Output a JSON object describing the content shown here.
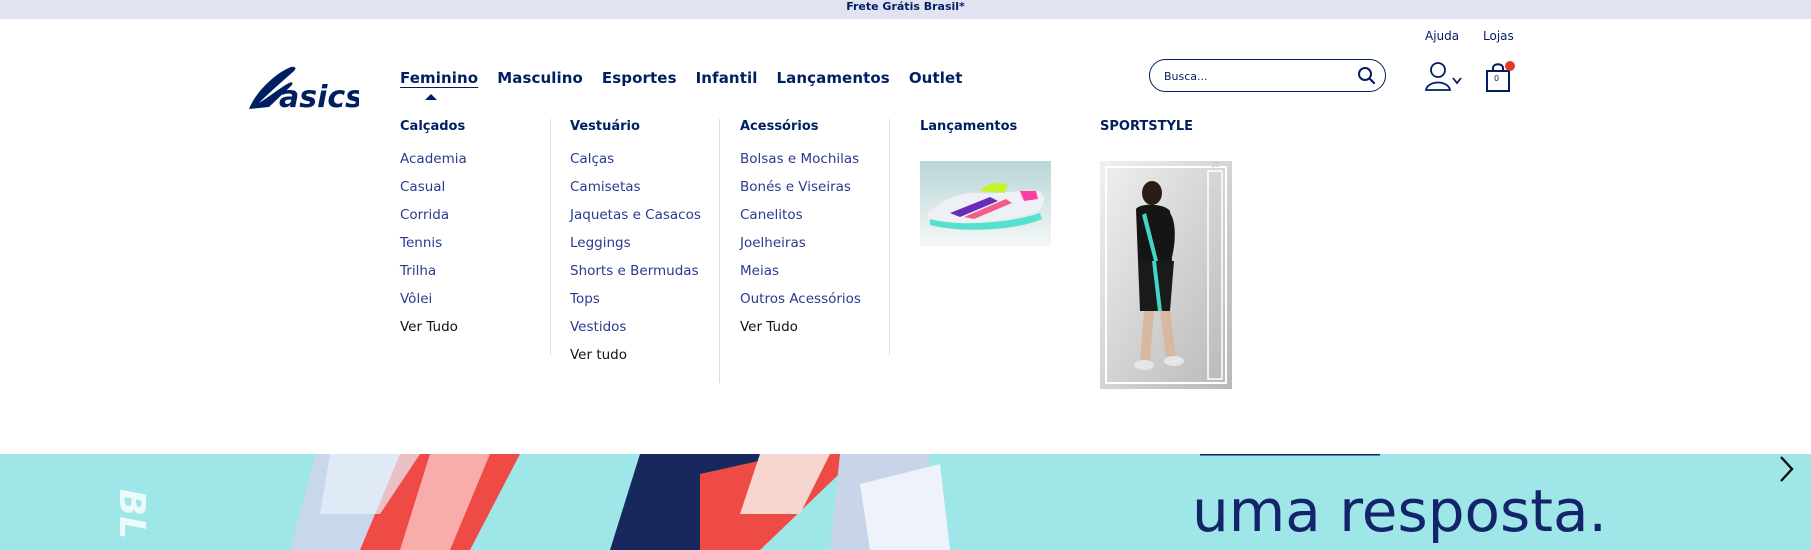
{
  "topbar": {
    "text": "Frete Grátis Brasil*"
  },
  "brand": {
    "logo_text": "asics"
  },
  "nav": {
    "items": [
      {
        "label": "Feminino"
      },
      {
        "label": "Masculino"
      },
      {
        "label": "Esportes"
      },
      {
        "label": "Infantil"
      },
      {
        "label": "Lançamentos"
      },
      {
        "label": "Outlet"
      }
    ],
    "active": "Feminino"
  },
  "utility": {
    "help": "Ajuda",
    "stores": "Lojas"
  },
  "search": {
    "placeholder": "Busca..."
  },
  "cart": {
    "count": "0"
  },
  "menu": {
    "calcados": {
      "title": "Calçados",
      "links": [
        "Academia",
        "Casual",
        "Corrida",
        "Tennis",
        "Trilha",
        "Vôlei"
      ],
      "all": "Ver Tudo"
    },
    "vestuario": {
      "title": "Vestuário",
      "links": [
        "Calças",
        "Camisetas",
        "Jaquetas e Casacos",
        "Leggings",
        "Shorts e Bermudas",
        "Tops",
        "Vestidos"
      ],
      "all": "Ver tudo"
    },
    "acessorios": {
      "title": "Acessórios",
      "links": [
        "Bolsas e Mochilas",
        "Bonés e Viseiras",
        "Canelitos",
        "Joelheiras",
        "Meias",
        "Outros Acessórios"
      ],
      "all": "Ver Tudo"
    },
    "lancamentos": {
      "title": "Lançamentos"
    },
    "sportstyle": {
      "title": "SPORTSTYLE",
      "vertical_text": "SPORTSTYLE"
    }
  },
  "banner": {
    "text": "uma resposta."
  },
  "colors": {
    "navy": "#001e62",
    "link": "#2b3a8f",
    "topbar": "#e2e3f0",
    "banner": "#9fe6e8",
    "badge": "#e03a2c"
  },
  "icons": [
    "search-icon",
    "user-icon",
    "chevron-down-icon",
    "shopping-bag-icon",
    "chevron-right-icon"
  ]
}
